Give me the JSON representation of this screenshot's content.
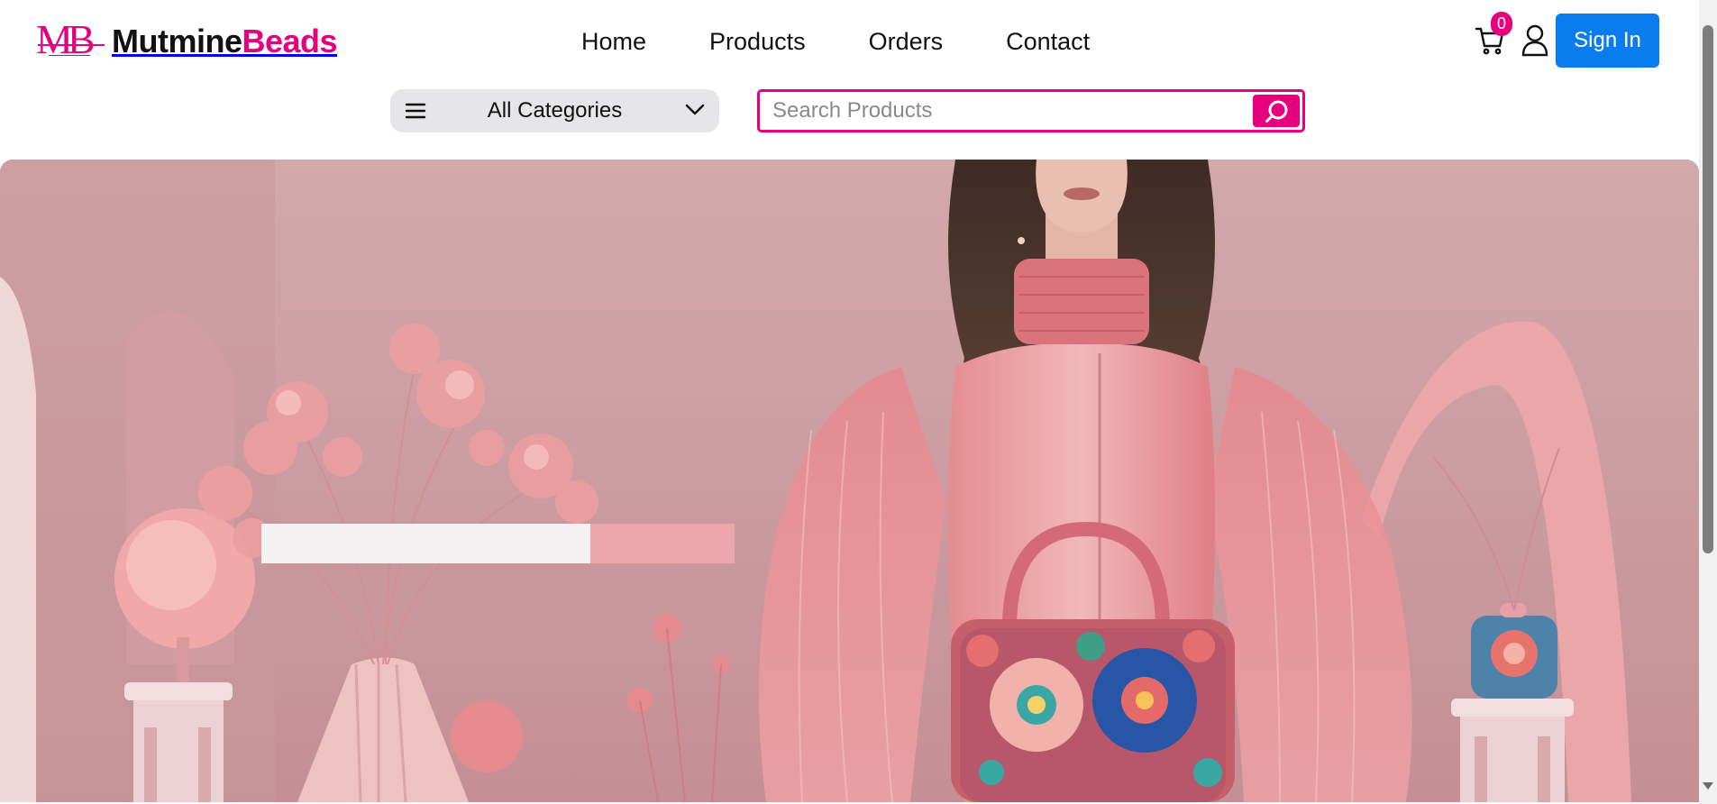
{
  "brand": {
    "mark": "MB",
    "name_part1": "Mutmine",
    "name_part2": "Beads",
    "primary_color": "#e6007e",
    "accent_blue": "#0a7cf0"
  },
  "nav": {
    "items": [
      {
        "label": "Home"
      },
      {
        "label": "Products"
      },
      {
        "label": "Orders"
      },
      {
        "label": "Contact"
      }
    ]
  },
  "header": {
    "cart_count": "0",
    "cart_icon": "cart-icon",
    "user_icon": "user-icon",
    "signin_label": "Sign In"
  },
  "category": {
    "selected": "All Categories",
    "menu_icon": "menu-icon",
    "chevron_icon": "chevron-down-icon"
  },
  "search": {
    "placeholder": "Search Products",
    "value": "",
    "icon": "search-icon"
  },
  "hero": {
    "image": "hero-banner"
  }
}
